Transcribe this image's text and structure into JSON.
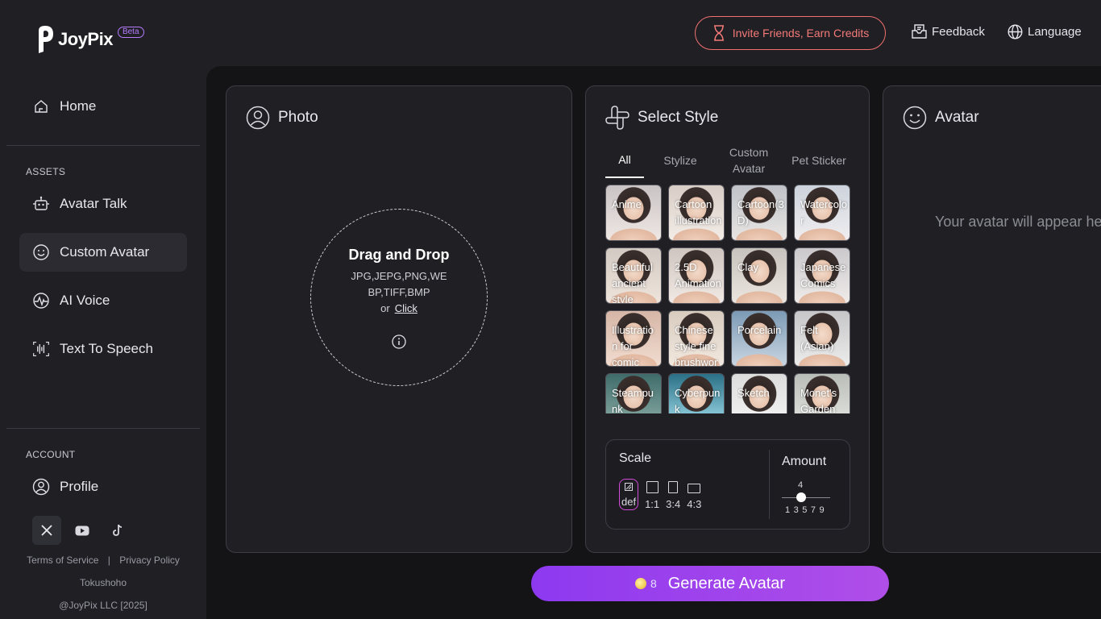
{
  "brand": {
    "name": "JoyPix",
    "badge": "Beta"
  },
  "header": {
    "invite_label": "Invite Friends, Earn Credits",
    "feedback_label": "Feedback",
    "language_label": "Language"
  },
  "sidebar": {
    "home_label": "Home",
    "assets_section": "ASSETS",
    "assets": [
      {
        "label": "Avatar Talk",
        "icon": "robot-icon"
      },
      {
        "label": "Custom Avatar",
        "icon": "smile-icon",
        "active": true
      },
      {
        "label": "AI Voice",
        "icon": "waveform-icon"
      },
      {
        "label": "Text To Speech",
        "icon": "speech-bars-icon"
      }
    ],
    "account_section": "ACCOUNT",
    "profile_label": "Profile",
    "socials": [
      "x-icon",
      "youtube-icon",
      "tiktok-icon"
    ],
    "terms_label": "Terms of Service",
    "separator": "|",
    "privacy_label": "Privacy Policy",
    "tokushoho_label": "Tokushoho",
    "copyright": "@JoyPix LLC [2025]"
  },
  "photo_panel": {
    "title": "Photo",
    "drop_title": "Drag and Drop",
    "formats": "JPG,JEPG,PNG,WEBP,TIFF,BMP",
    "or_label": "or",
    "click_label": "Click"
  },
  "style_panel": {
    "title": "Select Style",
    "tabs": [
      "All",
      "Stylize",
      "Custom Avatar",
      "Pet Sticker"
    ],
    "active_tab": "All",
    "styles": [
      "Anime",
      "Cartoon illustration",
      "Cartoon(3D)",
      "Watercolor",
      "Beautiful ancient style",
      "2.5D Animation",
      "Clay",
      "Japanese Comics",
      "Illustration for comic books",
      "Chinese style fine brushwork",
      "Porcelain",
      "Felt (Asian)",
      "Steampunk",
      "Cyberpunk",
      "Sketch",
      "Monet's Garden"
    ],
    "scale_title": "Scale",
    "ratios": [
      "def",
      "1:1",
      "3:4",
      "4:3"
    ],
    "selected_ratio": "def",
    "amount_title": "Amount",
    "amount_value": "4",
    "amount_ticks": [
      "1",
      "3",
      "5",
      "7",
      "9"
    ]
  },
  "avatar_panel": {
    "title": "Avatar",
    "placeholder": "Your avatar will appear here"
  },
  "generate": {
    "credits": "8",
    "label": "Generate Avatar"
  },
  "colors": {
    "accent": "#9b45ee",
    "invite": "#f2716f",
    "background": "#1f1f24",
    "main": "#141417"
  }
}
